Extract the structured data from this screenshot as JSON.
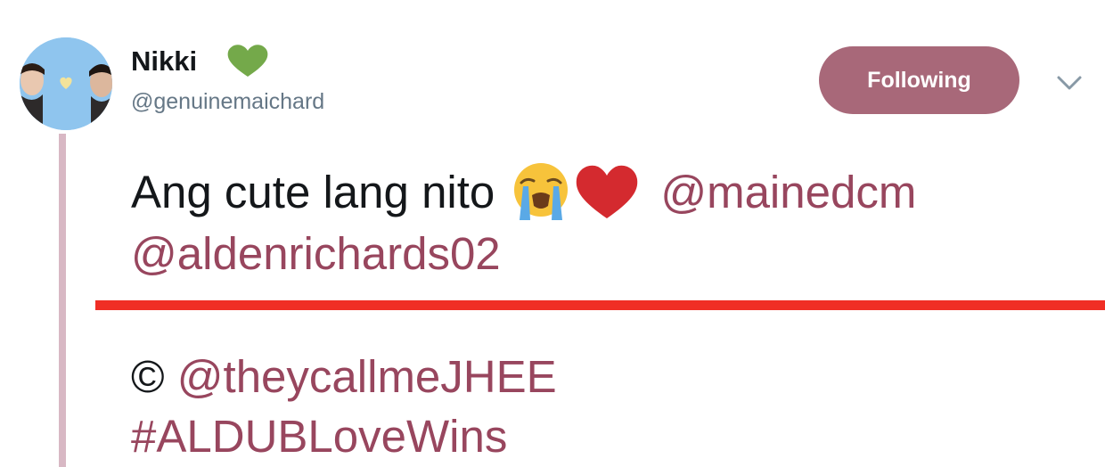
{
  "tweet": {
    "author": {
      "display_name": "Nikki",
      "handle": "@genuinemaichard",
      "name_emoji": "green-heart-icon"
    },
    "follow_button_label": "Following",
    "text": {
      "line1": "Ang cute lang nito",
      "emojis": [
        "loudly-crying-face-icon",
        "red-heart-icon"
      ],
      "mention1": "@mainedcm",
      "mention2": "@aldenrichards02",
      "credit_symbol": "©",
      "credit_mention": "@theycallmeJHEE",
      "hashtag": "#ALDUBLoveWins"
    }
  },
  "colors": {
    "accent": "#98465e",
    "button_bg": "#a86879",
    "rule": "#f02e25",
    "thread_line": "#d8b8c4",
    "avatar_bg": "#8fc5ee"
  }
}
